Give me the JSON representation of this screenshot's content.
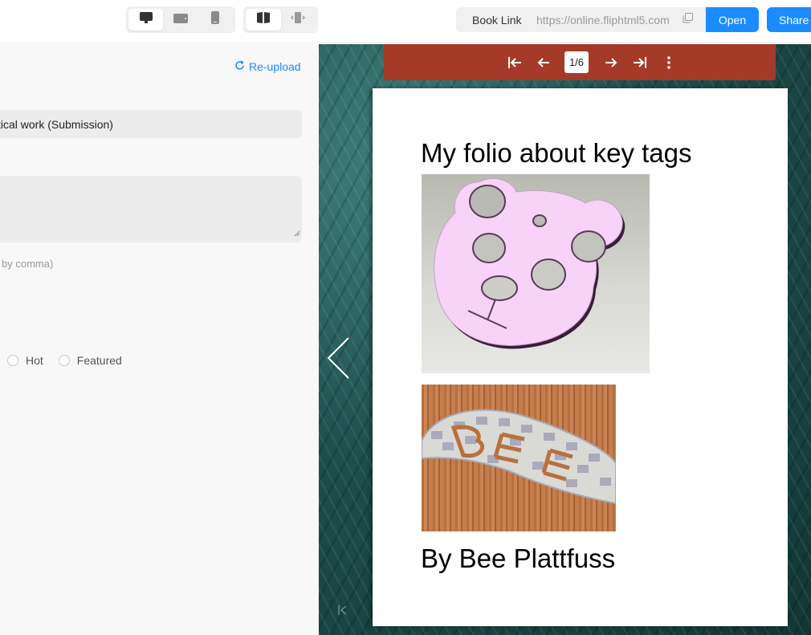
{
  "topbar": {
    "view_modes": [
      {
        "icon": "desktop-icon",
        "active": true
      },
      {
        "icon": "tablet-icon",
        "active": false
      },
      {
        "icon": "mobile-icon",
        "active": false
      }
    ],
    "layout_modes": [
      {
        "icon": "double-page-icon",
        "active": true
      },
      {
        "icon": "single-page-icon",
        "active": false
      }
    ],
    "book_link_label": "Book Link",
    "book_link_url": "https://online.fliphtml5.com",
    "open_label": "Open",
    "share_label": "Share",
    "accent_color": "#1a8cff"
  },
  "left_panel": {
    "reupload_label": "Re-upload",
    "title_value": "ctical work (Submission)",
    "tags_hint": "by comma)",
    "radio_options": [
      {
        "label": "Hot",
        "checked": false
      },
      {
        "label": "Featured",
        "checked": false
      }
    ]
  },
  "viewer": {
    "toolbar_color": "#a63a28",
    "page_indicator": "1/6",
    "toolbar_icons": [
      "first-page-icon",
      "previous-page-icon",
      "next-page-icon",
      "last-page-icon",
      "more-icon"
    ],
    "page": {
      "title": "My folio about key tags",
      "image1": "pink-bear-key-tag-render",
      "image2": "bee-key-tag-render-on-wood",
      "author": "By Bee Plattfuss"
    }
  }
}
